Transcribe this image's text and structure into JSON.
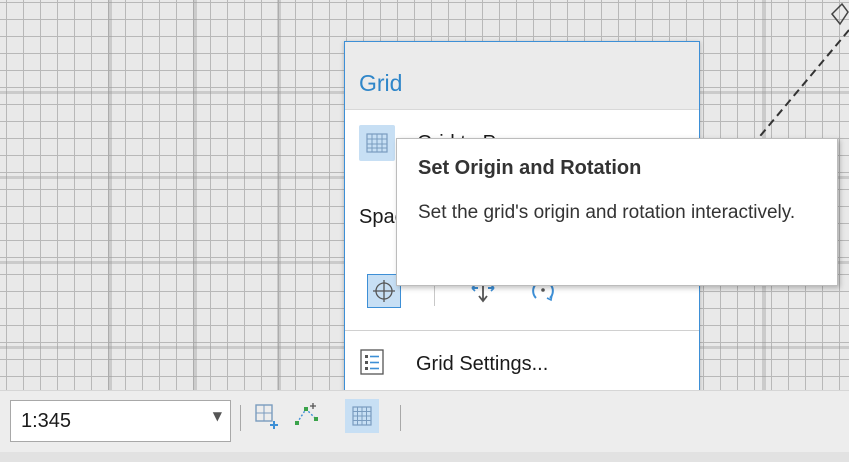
{
  "grid_panel": {
    "title": "Grid",
    "grid_row_label": "Grid to Paper",
    "spacing_label": "Spacing",
    "settings_label": "Grid Settings..."
  },
  "tooltip": {
    "title": "Set Origin and Rotation",
    "description": "Set the grid's origin and rotation interactively."
  },
  "statusbar": {
    "scale_value": "1:345"
  },
  "icons": {
    "grid_button": "grid-icon",
    "origin_tool": "crosshair-origin-icon",
    "move_tool": "move-origin-icon",
    "rotate_tool": "rotate-icon",
    "settings": "list-settings-icon",
    "snap_grid": "snap-to-grid-icon",
    "snap_points": "snap-points-icon",
    "grid_toggle": "grid-toggle-icon"
  },
  "colors": {
    "accent": "#2f86c9",
    "active_bg": "#c7dff4",
    "panel_border": "#3d8fd6"
  }
}
